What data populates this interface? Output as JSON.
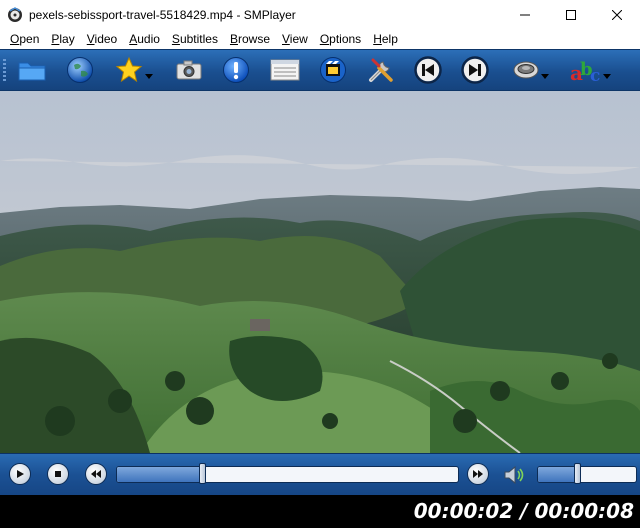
{
  "window": {
    "title": "pexels-sebissport-travel-5518429.mp4 - SMPlayer",
    "icon": "smplayer-icon",
    "controls": [
      "minimize-icon",
      "maximize-icon",
      "close-icon"
    ]
  },
  "menu": {
    "items": [
      {
        "first": "O",
        "rest": "pen"
      },
      {
        "first": "P",
        "rest": "lay"
      },
      {
        "first": "V",
        "rest": "ideo"
      },
      {
        "first": "A",
        "rest": "udio"
      },
      {
        "first": "S",
        "rest": "ubtitles"
      },
      {
        "first": "B",
        "rest": "rowse"
      },
      {
        "first": "V",
        "rest": "iew"
      },
      {
        "first": "O",
        "rest": "ptions"
      },
      {
        "first": "H",
        "rest": "elp"
      }
    ]
  },
  "toolbar": {
    "icons": [
      "open-folder-icon",
      "open-url-globe-icon",
      "favorites-star-icon",
      "screenshot-camera-icon",
      "info-icon",
      "playlist-icon",
      "video-filters-icon",
      "preferences-tools-icon",
      "previous-icon",
      "next-icon",
      "audio-track-icon",
      "subtitles-abc-icon"
    ]
  },
  "playback": {
    "current_time": "00:00:02",
    "total_time": "00:00:08",
    "separator": " / ",
    "progress": 0.25,
    "volume": 0.4
  },
  "colors": {
    "toolbar_blue": "#1a4f90",
    "status_bg": "#000000"
  }
}
